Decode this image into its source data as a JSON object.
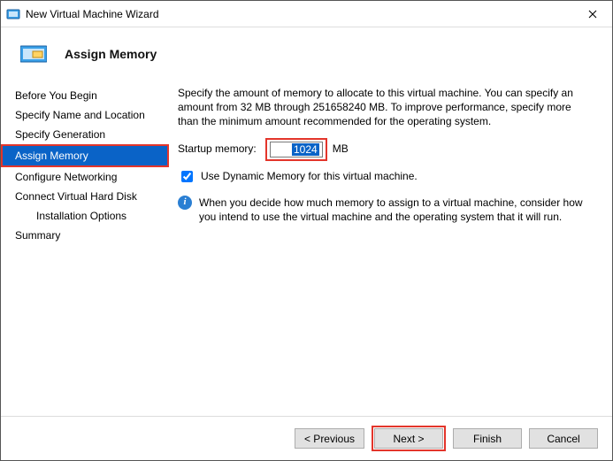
{
  "window": {
    "title": "New Virtual Machine Wizard"
  },
  "header": {
    "heading": "Assign Memory"
  },
  "nav": {
    "items": [
      {
        "label": "Before You Begin"
      },
      {
        "label": "Specify Name and Location"
      },
      {
        "label": "Specify Generation"
      },
      {
        "label": "Assign Memory"
      },
      {
        "label": "Configure Networking"
      },
      {
        "label": "Connect Virtual Hard Disk"
      },
      {
        "label": "Installation Options"
      },
      {
        "label": "Summary"
      }
    ]
  },
  "content": {
    "intro": "Specify the amount of memory to allocate to this virtual machine. You can specify an amount from 32 MB through 251658240 MB. To improve performance, specify more than the minimum amount recommended for the operating system.",
    "startup_label": "Startup memory:",
    "startup_value": "1024",
    "startup_unit": "MB",
    "dynamic_label": "Use Dynamic Memory for this virtual machine.",
    "info_text": "When you decide how much memory to assign to a virtual machine, consider how you intend to use the virtual machine and the operating system that it will run."
  },
  "footer": {
    "previous": "< Previous",
    "next": "Next >",
    "finish": "Finish",
    "cancel": "Cancel"
  }
}
